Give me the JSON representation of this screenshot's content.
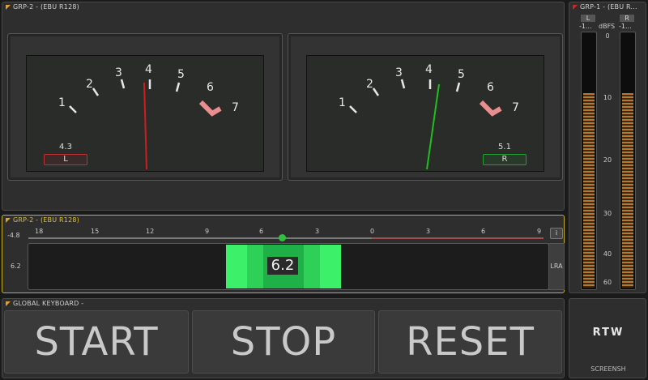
{
  "vu_panel": {
    "title": "GRP-2 - (EBU R128)",
    "scale": [
      "1",
      "2",
      "3",
      "4",
      "5",
      "6",
      "7"
    ],
    "meters": [
      {
        "channel": "L",
        "value_text": "4.3",
        "needle_color": "#cc1e1e",
        "channel_border": "#c03030"
      },
      {
        "channel": "R",
        "value_text": "5.1",
        "needle_color": "#1fbf1f",
        "channel_border": "#20a030"
      }
    ]
  },
  "lra_panel": {
    "title": "GRP-2 - (EBU R128)",
    "scale_labels": [
      "18",
      "15",
      "12",
      "9",
      "6",
      "3",
      "0",
      "3",
      "6",
      "9"
    ],
    "left_top": "-4.8",
    "left_mid": "6.2",
    "value": "6.2",
    "lra_label": "LRA",
    "info_button": "i",
    "accent": "#3cf06a"
  },
  "dbfs_panel": {
    "title": "GRP-1 - (EBU R...",
    "left_label": "L",
    "right_label": "R",
    "left_peak": "-1...",
    "right_peak": "-1...",
    "unit": "dBFS",
    "scale": [
      "0",
      "10",
      "20",
      "30",
      "40",
      "60"
    ]
  },
  "keyboard": {
    "title": "GLOBAL KEYBOARD -",
    "start": "START",
    "stop": "STOP",
    "reset": "RESET"
  },
  "logo": {
    "text": "RTW",
    "caption": "SCREENSH"
  }
}
